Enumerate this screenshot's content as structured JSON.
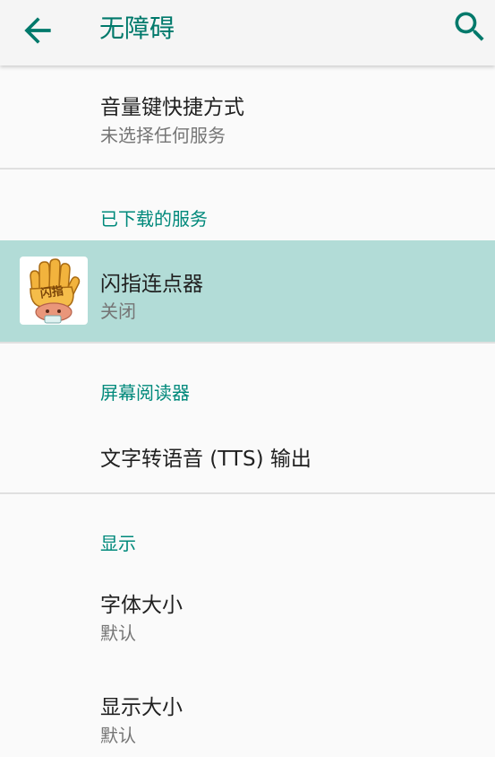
{
  "header": {
    "title": "无障碍",
    "back_icon": "arrow-left-icon",
    "search_icon": "search-icon"
  },
  "items": {
    "volume_shortcut": {
      "title": "音量键快捷方式",
      "summary": "未选择任何服务"
    },
    "downloaded_category": "已下载的服务",
    "flash_clicker": {
      "title": "闪指连点器",
      "summary": "关闭",
      "icon": "glove-app-icon",
      "icon_text": "闪指"
    },
    "screen_reader_category": "屏幕阅读器",
    "tts": {
      "title": "文字转语音 (TTS) 输出"
    },
    "display_category": "显示",
    "font_size": {
      "title": "字体大小",
      "summary": "默认"
    },
    "display_size": {
      "title": "显示大小",
      "summary": "默认"
    }
  },
  "colors": {
    "accent": "#00796b",
    "category": "#00897b",
    "selected_bg": "#b2dcd7",
    "background": "#fafafa"
  }
}
